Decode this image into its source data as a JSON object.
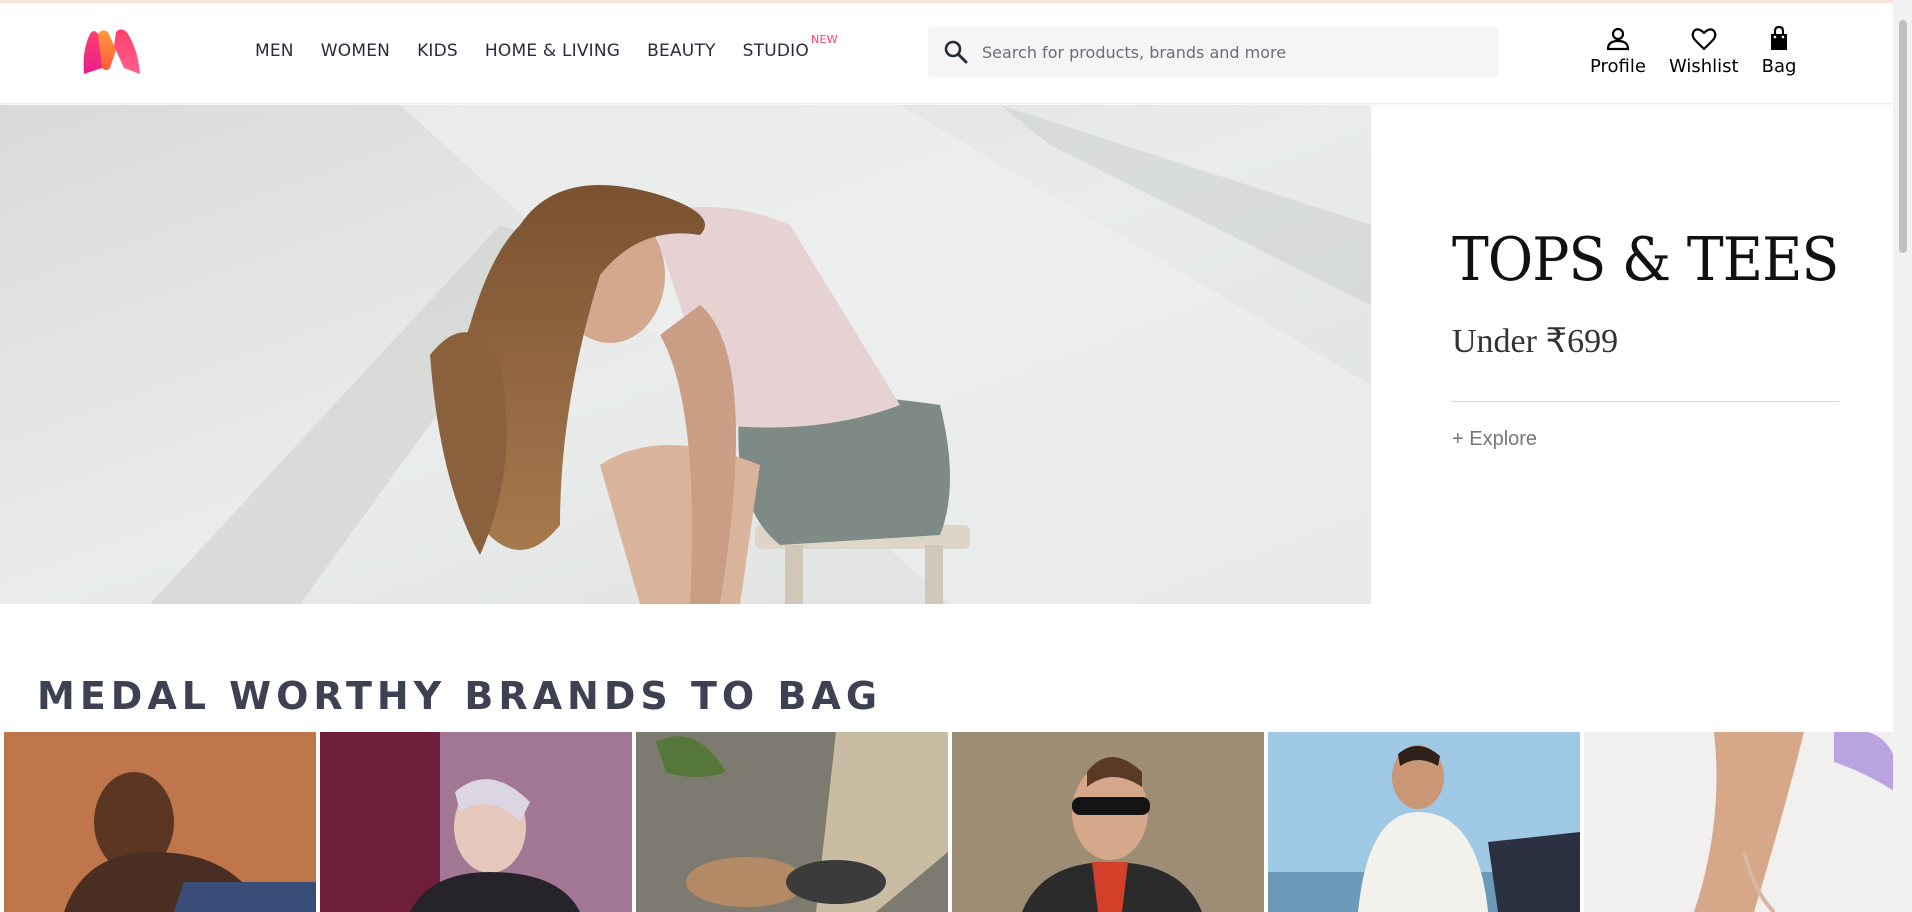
{
  "header": {
    "logo_name": "myntra-logo",
    "nav": [
      {
        "label": "MEN"
      },
      {
        "label": "WOMEN"
      },
      {
        "label": "KIDS"
      },
      {
        "label": "HOME & LIVING"
      },
      {
        "label": "BEAUTY"
      },
      {
        "label": "STUDIO",
        "badge": "NEW"
      }
    ],
    "search": {
      "placeholder": "Search for products, brands and more",
      "value": "",
      "icon": "search-icon"
    },
    "actions": [
      {
        "label": "Profile",
        "icon": "person-icon"
      },
      {
        "label": "Wishlist",
        "icon": "heart-icon"
      },
      {
        "label": "Bag",
        "icon": "shopping-bag-icon"
      }
    ]
  },
  "hero": {
    "title": "TOPS & TEES",
    "subtitle": "Under ₹699",
    "cta": "+ Explore"
  },
  "section": {
    "title": "MEDAL WORTHY BRANDS TO BAG"
  },
  "colors": {
    "accent": "#ff3f6c",
    "text": "#282c3f",
    "section_title": "#3e4152",
    "search_bg": "#f5f5f6"
  }
}
